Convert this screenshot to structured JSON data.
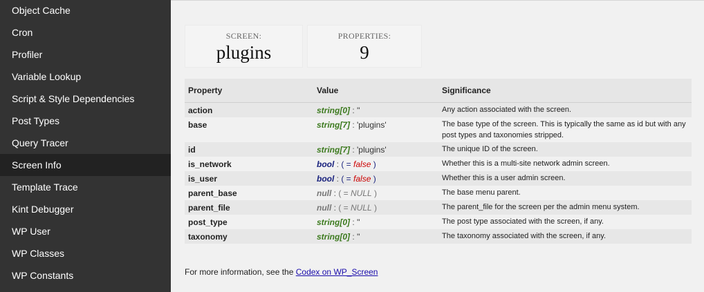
{
  "sidebar": {
    "items": [
      {
        "label": "Object Cache"
      },
      {
        "label": "Cron"
      },
      {
        "label": "Profiler"
      },
      {
        "label": "Variable Lookup"
      },
      {
        "label": "Script & Style Dependencies"
      },
      {
        "label": "Post Types"
      },
      {
        "label": "Query Tracer"
      },
      {
        "label": "Screen Info"
      },
      {
        "label": "Template Trace"
      },
      {
        "label": "Kint Debugger"
      },
      {
        "label": "WP User"
      },
      {
        "label": "WP Classes"
      },
      {
        "label": "WP Constants"
      }
    ],
    "active": "Screen Info"
  },
  "stats": {
    "screen_label": "SCREEN:",
    "screen_value": "plugins",
    "properties_label": "PROPERTIES:",
    "properties_value": "9"
  },
  "table": {
    "headers": {
      "property": "Property",
      "value": "Value",
      "significance": "Significance"
    },
    "rows": [
      {
        "property": "action",
        "type": "string[0]",
        "value": "''",
        "significance": "Any action associated with the screen."
      },
      {
        "property": "base",
        "type": "string[7]",
        "value": "'plugins'",
        "significance": "The base type of the screen. This is typically the same as id but with any post types and taxonomies stripped."
      },
      {
        "property": "id",
        "type": "string[7]",
        "value": "'plugins'",
        "significance": "The unique ID of the screen."
      },
      {
        "property": "is_network",
        "type": "bool",
        "value": "false",
        "significance": "Whether this is a multi-site network admin screen."
      },
      {
        "property": "is_user",
        "type": "bool",
        "value": "false",
        "significance": "Whether this is a user admin screen."
      },
      {
        "property": "parent_base",
        "type": "null",
        "value": "NULL",
        "significance": "The base menu parent."
      },
      {
        "property": "parent_file",
        "type": "null",
        "value": "NULL",
        "significance": "The parent_file for the screen per the admin menu system."
      },
      {
        "property": "post_type",
        "type": "string[0]",
        "value": "''",
        "significance": "The post type associated with the screen, if any."
      },
      {
        "property": "taxonomy",
        "type": "string[0]",
        "value": "''",
        "significance": "The taxonomy associated with the screen, if any."
      }
    ]
  },
  "footer": {
    "text": "For more information, see the ",
    "link": "Codex on WP_Screen"
  }
}
